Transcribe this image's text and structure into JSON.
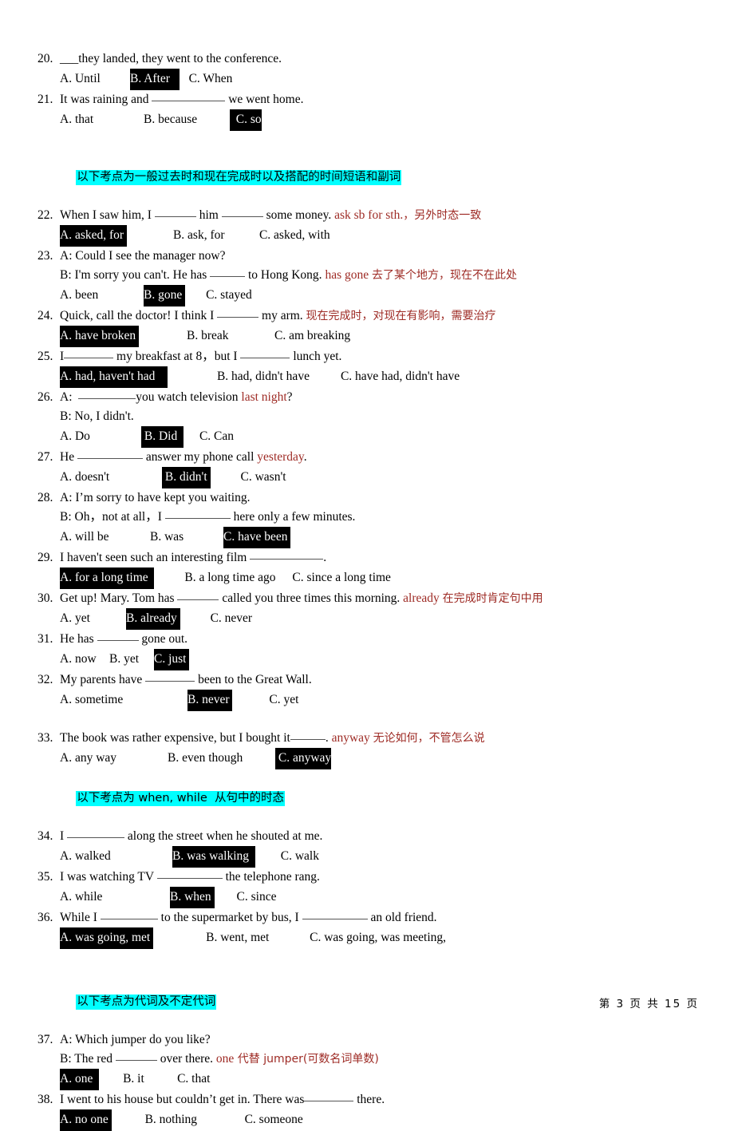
{
  "document": {
    "footer": "第 3 页 共 15 页",
    "accent_cyan": "#00ffff",
    "accent_red": "#9e2b25",
    "highlight_black": "#000000"
  },
  "questions": [
    {
      "num": "20.",
      "stem_pre": "___they landed, they went to the conference.",
      "options": [
        {
          "label": "A. Until",
          "hl": false
        },
        {
          "label": "B. After",
          "hl": true
        },
        {
          "label": "C. When",
          "hl": false
        }
      ]
    },
    {
      "num": "21.",
      "stem_pre": "It was raining and",
      "stem_post": "we went home.",
      "options": [
        {
          "label": "A. that",
          "hl": false
        },
        {
          "label": "B. because",
          "hl": false
        },
        {
          "label": "C. so",
          "hl": true
        }
      ]
    },
    {
      "num": "22.",
      "stem_pre": "When I saw him, I",
      "stem_mid": "him",
      "stem_post": "some money.",
      "note_en": "ask sb for sth.",
      "note_cn": "，另外时态一致",
      "options": [
        {
          "label": "A. asked, for",
          "hl": true
        },
        {
          "label": "B. ask, for",
          "hl": false
        },
        {
          "label": "C. asked, with",
          "hl": false
        }
      ]
    },
    {
      "num": "23.",
      "line_a": "A: Could I see the manager now?",
      "line_b_pre": "B: I'm sorry you can't. He has",
      "line_b_post": "to Hong Kong.",
      "note_en": "has gone",
      "note_cn": "去了某个地方，现在不在此处",
      "options": [
        {
          "label": "A. been",
          "hl": false
        },
        {
          "label": "B. gone",
          "hl": true
        },
        {
          "label": "C. stayed",
          "hl": false
        }
      ]
    },
    {
      "num": "24.",
      "stem_pre": "Quick, call the doctor! I think I",
      "stem_post": "my arm.",
      "note_cn": "现在完成时，对现在有影响，需要治疗",
      "options": [
        {
          "label": "A. have broken",
          "hl": true
        },
        {
          "label": "B. break",
          "hl": false
        },
        {
          "label": "C. am breaking",
          "hl": false
        }
      ]
    },
    {
      "num": "25.",
      "stem_pre": "I",
      "stem_mid": "my breakfast at 8，but I",
      "stem_post": "lunch yet.",
      "options": [
        {
          "label": "A. had, haven't had",
          "hl": true
        },
        {
          "label": "B. had, didn't have",
          "hl": false
        },
        {
          "label": "C. have had, didn't have",
          "hl": false
        }
      ]
    },
    {
      "num": "26.",
      "line_a_pre": "A:",
      "line_a_mid": "you watch television",
      "line_a_red": "last night",
      "line_a_post": "?",
      "line_b": "B: No, I didn't.",
      "options": [
        {
          "label": "A. Do",
          "hl": false
        },
        {
          "label": "B. Did",
          "hl": true
        },
        {
          "label": "C. Can",
          "hl": false
        }
      ]
    },
    {
      "num": "27.",
      "stem_pre": "He",
      "stem_mid": "answer my phone call",
      "stem_red": "yesterday",
      "stem_post": ".",
      "options": [
        {
          "label": "A. doesn't",
          "hl": false
        },
        {
          "label": "B. didn't",
          "hl": true
        },
        {
          "label": "C. wasn't",
          "hl": false
        }
      ]
    },
    {
      "num": "28.",
      "line_a": "A: I’m sorry to have kept you waiting.",
      "line_b_pre": "B: Oh，not at all，I",
      "line_b_post": "here only a few minutes.",
      "options": [
        {
          "label": "A. will be",
          "hl": false
        },
        {
          "label": "B. was",
          "hl": false
        },
        {
          "label": "C. have been",
          "hl": true
        }
      ]
    },
    {
      "num": "29.",
      "stem_pre": "I haven't seen such an interesting film",
      "stem_post": ".",
      "options": [
        {
          "label": "A. for a long time",
          "hl": true
        },
        {
          "label": "B. a long time ago",
          "hl": false
        },
        {
          "label": "C. since a long time",
          "hl": false
        }
      ]
    },
    {
      "num": "30.",
      "stem_pre": "Get up! Mary. Tom has",
      "stem_post": "called you three times this morning.",
      "note_en": "already",
      "note_cn": "在完成时肯定句中用",
      "options": [
        {
          "label": "A. yet",
          "hl": false
        },
        {
          "label": "B. already",
          "hl": true
        },
        {
          "label": "C. never",
          "hl": false
        }
      ]
    },
    {
      "num": "31.",
      "stem_pre": "He has",
      "stem_post": "gone out.",
      "options": [
        {
          "label": "A. now",
          "hl": false
        },
        {
          "label": "B. yet",
          "hl": false
        },
        {
          "label": "C. just",
          "hl": true
        }
      ]
    },
    {
      "num": "32.",
      "stem_pre": "My parents have",
      "stem_post": "been to the Great Wall.",
      "options": [
        {
          "label": "A. sometime",
          "hl": false
        },
        {
          "label": "B. never",
          "hl": true
        },
        {
          "label": "C. yet",
          "hl": false
        }
      ]
    },
    {
      "num": "33.",
      "stem_pre": "The book was rather expensive, but I bought it",
      "stem_post": ".",
      "note_en": "anyway",
      "note_cn": "无论如何，不管怎么说",
      "options": [
        {
          "label": "A. any way",
          "hl": false
        },
        {
          "label": "B. even though",
          "hl": false
        },
        {
          "label": "C. anyway",
          "hl": true
        }
      ]
    },
    {
      "num": "34.",
      "stem_pre": "I",
      "stem_post": "along the street when he shouted at me.",
      "options": [
        {
          "label": "A. walked",
          "hl": false
        },
        {
          "label": "B. was walking",
          "hl": true
        },
        {
          "label": "C. walk",
          "hl": false
        }
      ]
    },
    {
      "num": "35.",
      "stem_pre": "I was watching TV",
      "stem_post": "the telephone rang.",
      "options": [
        {
          "label": "A. while",
          "hl": false
        },
        {
          "label": "B. when",
          "hl": true
        },
        {
          "label": "C. since",
          "hl": false
        }
      ]
    },
    {
      "num": "36.",
      "stem_pre": "While I",
      "stem_mid": "to the supermarket by bus, I",
      "stem_post": "an old friend.",
      "options": [
        {
          "label": "A. was going, met",
          "hl": true
        },
        {
          "label": "B. went, met",
          "hl": false
        },
        {
          "label": "C. was going, was meeting,",
          "hl": false
        }
      ]
    },
    {
      "num": "37.",
      "line_a": "A: Which jumper do you like?",
      "line_b_pre": "B: The red",
      "line_b_post": "over there.",
      "note_en": "one",
      "note_cn": " 代替 jumper(可数名词单数)",
      "options": [
        {
          "label": "A. one",
          "hl": true
        },
        {
          "label": "B. it",
          "hl": false
        },
        {
          "label": "C. that",
          "hl": false
        }
      ]
    },
    {
      "num": "38.",
      "stem_pre": "I went to his house but couldn’t get in. There was",
      "stem_post": "there.",
      "options": [
        {
          "label": "A. no one",
          "hl": true
        },
        {
          "label": "B. nothing",
          "hl": false
        },
        {
          "label": "C. someone",
          "hl": false
        }
      ]
    }
  ],
  "sections": [
    {
      "id": "sec1",
      "text": "以下考点为一般过去时和现在完成时以及搭配的时间短语和副词"
    },
    {
      "id": "sec2",
      "text": "以下考点为 when, while  从句中的时态"
    },
    {
      "id": "sec3",
      "text": "以下考点为代词及不定代词"
    }
  ]
}
